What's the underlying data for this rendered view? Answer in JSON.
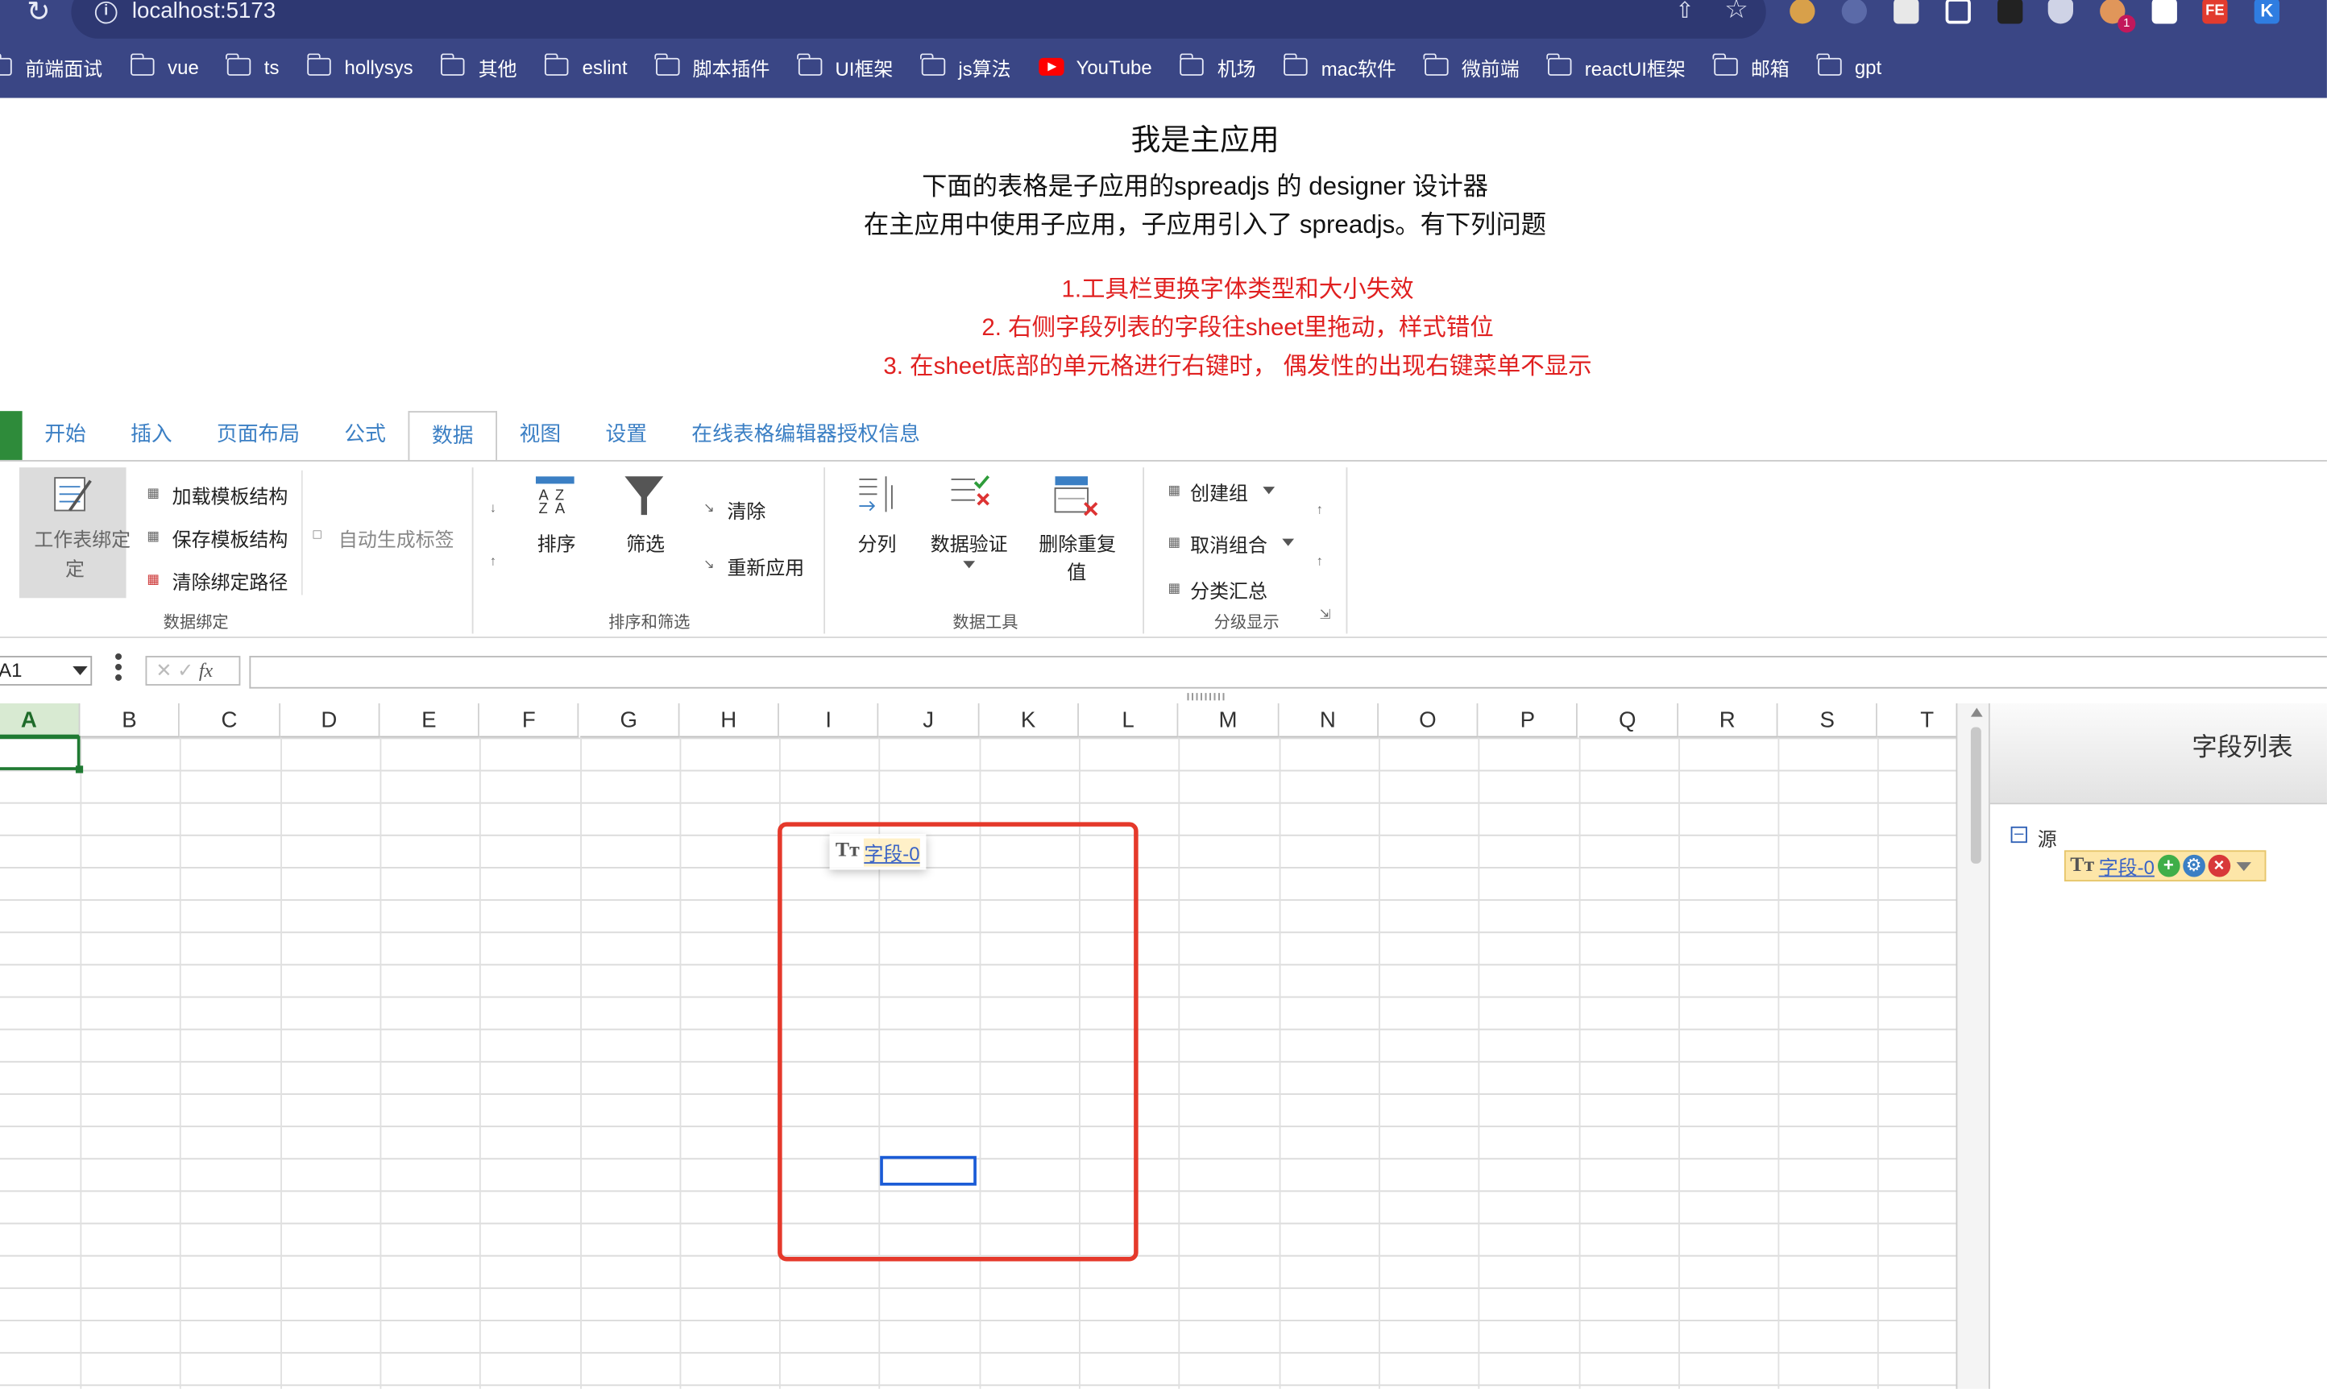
{
  "browser": {
    "url": "localhost:5173",
    "bookmarks": [
      "前端面试",
      "vue",
      "ts",
      "hollysys",
      "其他",
      "eslint",
      "脚本插件",
      "UI框架",
      "js算法",
      "YouTube",
      "机场",
      "mac软件",
      "微前端",
      "reactUI框架",
      "邮箱",
      "gpt"
    ],
    "ext_badge": "1",
    "ext_fe": "FE",
    "ext_k": "K"
  },
  "page": {
    "title": "我是主应用",
    "subtitle1": "下面的表格是子应用的spreadjs 的 designer 设计器",
    "subtitle2": "在主应用中使用子应用，子应用引入了 spreadjs。有下列问题",
    "issues": [
      "1.工具栏更换字体类型和大小失效",
      "2. 右侧字段列表的字段往sheet里拖动，样式错位",
      "3. 在sheet底部的单元格进行右键时， 偶发性的出现右键菜单不显示"
    ]
  },
  "ribbon": {
    "tabs": [
      "开始",
      "插入",
      "页面布局",
      "公式",
      "数据",
      "视图",
      "设置",
      "在线表格编辑器授权信息"
    ],
    "active_tab": "数据",
    "binding": {
      "worksheet_bind": "工作表绑定",
      "load": "加载模板结构",
      "save": "保存模板结构",
      "clear": "清除绑定路径",
      "auto_label": "自动生成标签",
      "group_label": "数据绑定"
    },
    "sortfilter": {
      "sort": "排序",
      "filter": "筛选",
      "clear": "清除",
      "reapply": "重新应用",
      "group_label": "排序和筛选"
    },
    "tools": {
      "split": "分列",
      "validate": "数据验证",
      "dedupe1": "删除重复",
      "dedupe2": "值",
      "group_label": "数据工具"
    },
    "outline": {
      "create_group": "创建组",
      "ungroup": "取消组合",
      "subtotal": "分类汇总",
      "group_label": "分级显示"
    }
  },
  "formula_bar": {
    "name_box": "A1",
    "fx": "fx"
  },
  "grid": {
    "columns": [
      "A",
      "B",
      "C",
      "D",
      "E",
      "F",
      "G",
      "H",
      "I",
      "J",
      "K",
      "L",
      "M",
      "N",
      "O",
      "P",
      "Q",
      "R",
      "S",
      "T"
    ],
    "selected_col": "A",
    "drag_field": "字段-0"
  },
  "field_panel": {
    "title": "字段列表",
    "source": "源",
    "field": "字段-0"
  }
}
